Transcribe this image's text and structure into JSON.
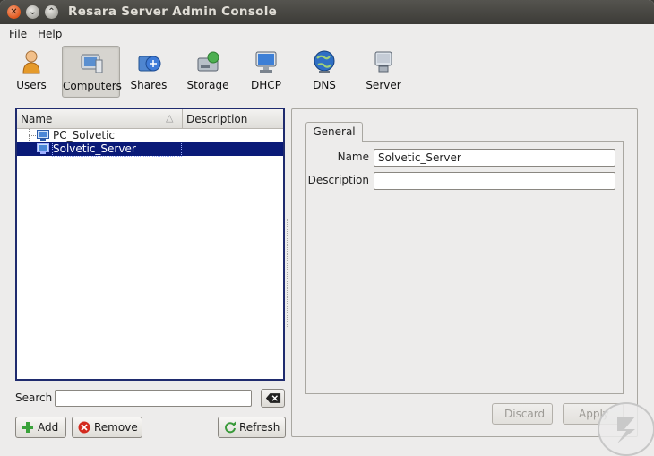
{
  "window": {
    "title": "Resara Server Admin Console"
  },
  "menu": [
    {
      "label": "File",
      "mnemonic": "F"
    },
    {
      "label": "Help",
      "mnemonic": "H"
    }
  ],
  "toolbar": {
    "active": "Computers",
    "items": [
      {
        "label": "Users",
        "icon": "user-icon"
      },
      {
        "label": "Computers",
        "icon": "computer-icon"
      },
      {
        "label": "Shares",
        "icon": "shares-icon"
      },
      {
        "label": "Storage",
        "icon": "storage-icon"
      },
      {
        "label": "DHCP",
        "icon": "monitor-icon"
      },
      {
        "label": "DNS",
        "icon": "globe-icon"
      },
      {
        "label": "Server",
        "icon": "server-icon"
      }
    ]
  },
  "list": {
    "columns": {
      "name": "Name",
      "description": "Description"
    },
    "rows": [
      {
        "name": "PC_Solvetic",
        "description": "",
        "selected": false
      },
      {
        "name": "Solvetic_Server",
        "description": "",
        "selected": true
      }
    ]
  },
  "search": {
    "label": "Search",
    "value": ""
  },
  "buttons": {
    "add": "Add",
    "remove": "Remove",
    "refresh": "Refresh",
    "discard": "Discard",
    "apply": "Apply"
  },
  "details": {
    "tab": "General",
    "name_label": "Name",
    "name_value": "Solvetic_Server",
    "description_label": "Description",
    "description_value": ""
  },
  "colors": {
    "selection": "#0a1a78",
    "titlebar": "#3c3b37",
    "close_button": "#e0561c"
  }
}
